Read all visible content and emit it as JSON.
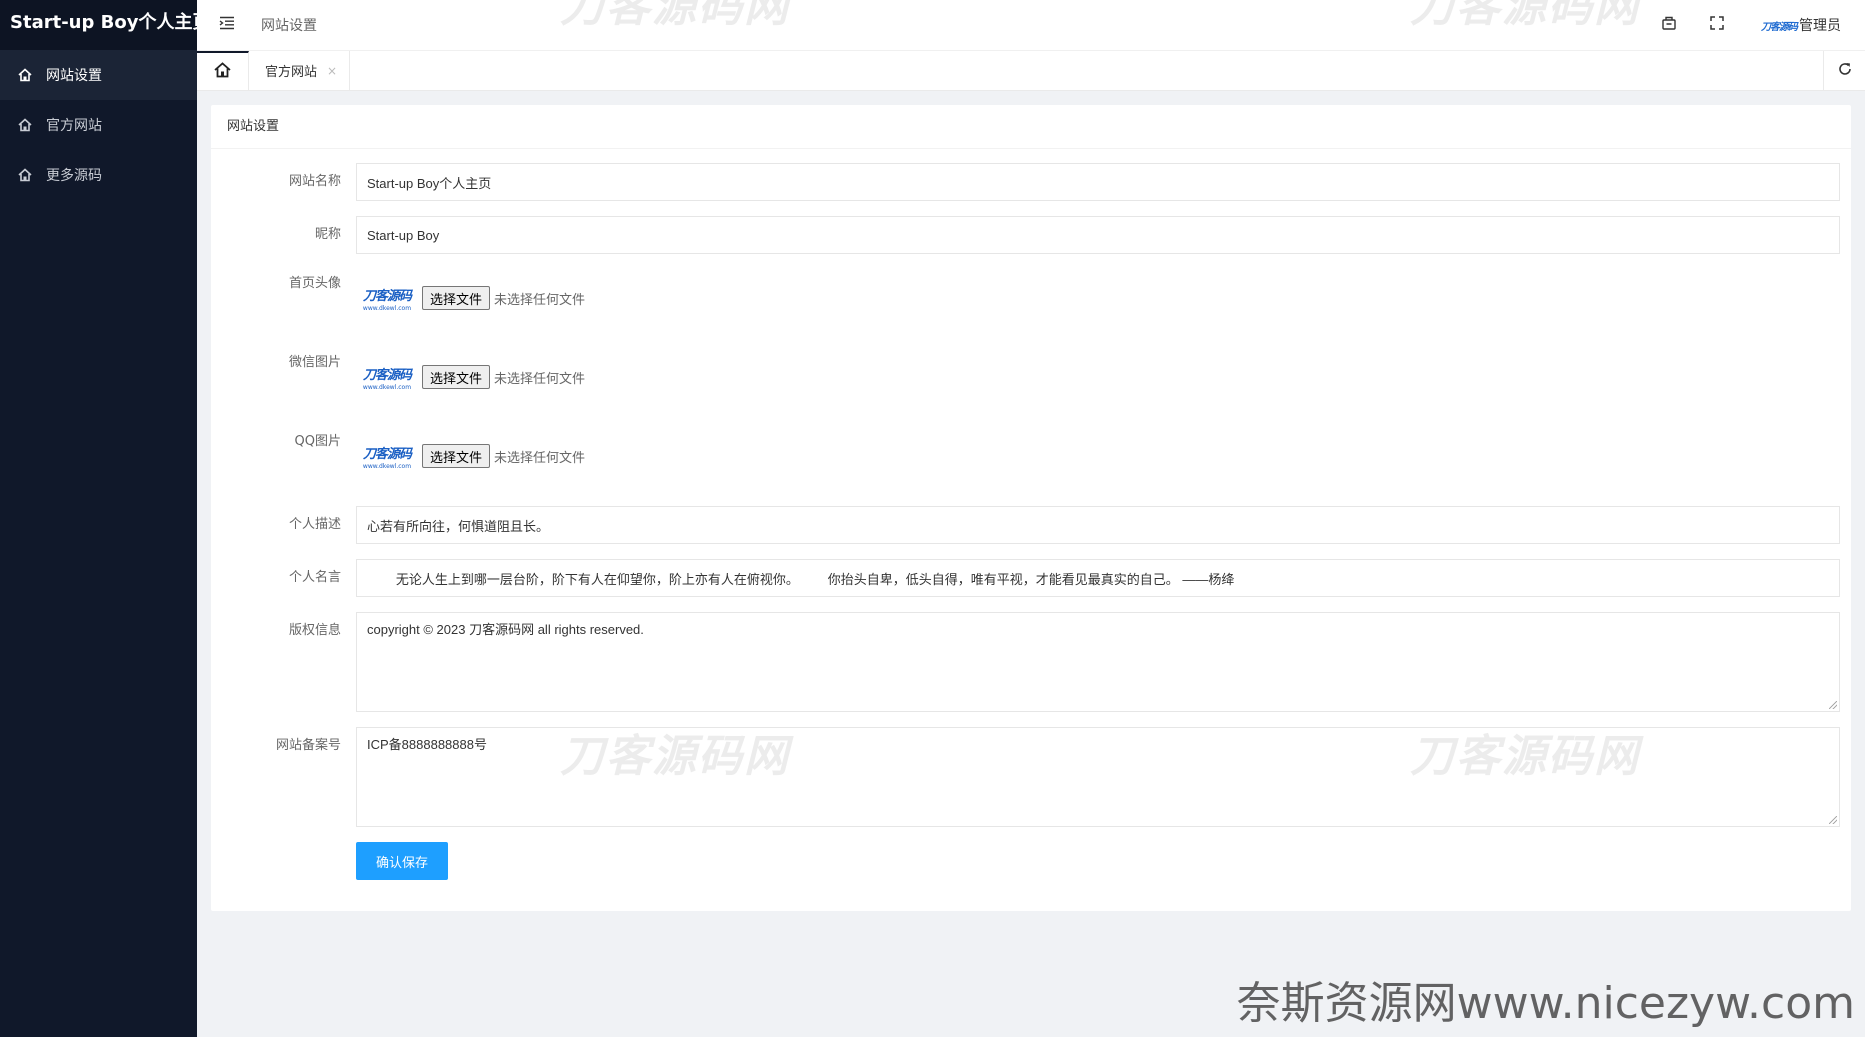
{
  "sidebar": {
    "brand": "Start-up Boy个人主页",
    "items": [
      {
        "label": "网站设置",
        "icon": "home-icon",
        "active": true
      },
      {
        "label": "官方网站",
        "icon": "home-icon",
        "active": false
      },
      {
        "label": "更多源码",
        "icon": "home-icon",
        "active": false
      }
    ]
  },
  "header": {
    "breadcrumb": "网站设置",
    "user_logo_text": "刀客源码",
    "user_name": "管理员",
    "icons": [
      "menu-toggle-icon",
      "clear-cache-icon",
      "fullscreen-icon"
    ]
  },
  "tabs": {
    "items": [
      {
        "label": "官方网站",
        "close": "×"
      }
    ],
    "icons": [
      "home-icon",
      "refresh-icon"
    ]
  },
  "card": {
    "title": "网站设置"
  },
  "form": {
    "site_name": {
      "label": "网站名称",
      "value": "Start-up Boy个人主页"
    },
    "nickname": {
      "label": "昵称",
      "value": "Start-up Boy"
    },
    "avatar": {
      "label": "首页头像",
      "button": "选择文件",
      "status": "未选择任何文件"
    },
    "wechat": {
      "label": "微信图片",
      "button": "选择文件",
      "status": "未选择任何文件"
    },
    "qq": {
      "label": "QQ图片",
      "button": "选择文件",
      "status": "未选择任何文件"
    },
    "thumb_logo": "刀客源码",
    "thumb_sub": "www.dkewl.com",
    "description": {
      "label": "个人描述",
      "value": "心若有所向往，何惧道阻且长。"
    },
    "motto": {
      "label": "个人名言",
      "value": "        无论人生上到哪一层台阶，阶下有人在仰望你，阶上亦有人在俯视你。        你抬头自卑，低头自得，唯有平视，才能看见最真实的自己。 ——杨绛"
    },
    "copyright": {
      "label": "版权信息",
      "value": "copyright © 2023 刀客源码网 all rights reserved."
    },
    "icp": {
      "label": "网站备案号",
      "value": "ICP备8888888888号"
    },
    "save_label": "确认保存"
  },
  "watermarks": {
    "brand": "刀客源码网",
    "site": "奈斯资源网www.nicezyw.com"
  },
  "colors": {
    "sidebar_bg": "#10182a",
    "primary_button": "#1e9fff"
  }
}
